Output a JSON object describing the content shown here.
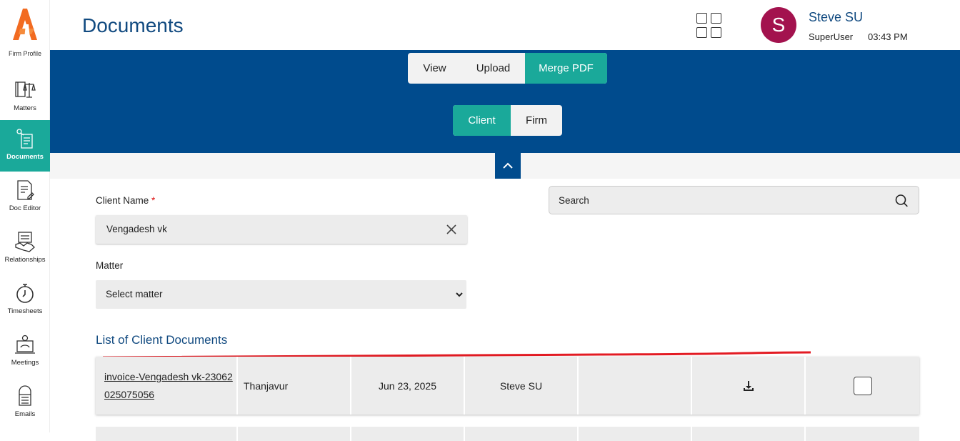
{
  "sidebar": {
    "firm_profile_label": "Firm Profile",
    "items": [
      {
        "label": "Matters",
        "icon": "scales-book-icon"
      },
      {
        "label": "Documents",
        "icon": "documents-icon",
        "active": true
      },
      {
        "label": "Doc Editor",
        "icon": "doc-editor-icon"
      },
      {
        "label": "Relationships",
        "icon": "handshake-icon"
      },
      {
        "label": "Timesheets",
        "icon": "stopwatch-icon"
      },
      {
        "label": "Meetings",
        "icon": "meeting-icon"
      },
      {
        "label": "Emails",
        "icon": "mailbox-icon"
      }
    ]
  },
  "header": {
    "title": "Documents",
    "user": {
      "initial": "S",
      "name": "Steve SU",
      "role": "SuperUser",
      "time": "03:43 PM"
    }
  },
  "tabs": {
    "primary": [
      "View",
      "Upload",
      "Merge PDF"
    ],
    "primary_active": "Merge PDF",
    "secondary": [
      "Client",
      "Firm"
    ],
    "secondary_active": "Client"
  },
  "form": {
    "client_label": "Client Name",
    "required_mark": "*",
    "client_value": "Vengadesh vk",
    "matter_label": "Matter",
    "matter_value": "Select matter",
    "search_placeholder": "Search"
  },
  "list": {
    "title": "List of Client Documents",
    "rows": [
      {
        "name": "invoice-Vengadesh vk-23062025075056",
        "location": "Thanjavur",
        "date": "Jun 23, 2025",
        "uploaded_by": "Steve SU",
        "extra": "",
        "checked": false
      }
    ]
  },
  "colors": {
    "brand_blue": "#004b8d",
    "accent_teal": "#1aa99a",
    "title_blue": "#114a80",
    "avatar": "#a3124e"
  }
}
